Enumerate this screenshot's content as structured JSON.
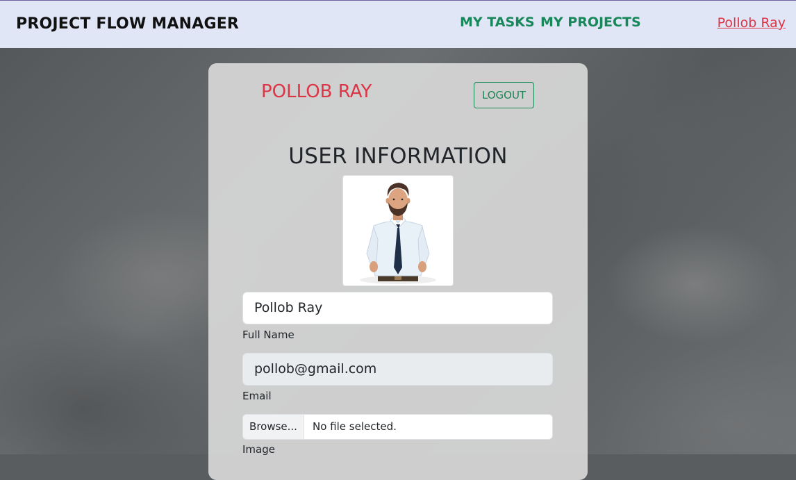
{
  "navbar": {
    "brand": "PROJECT FLOW MANAGER",
    "links": [
      "MY TASKS",
      "MY PROJECTS"
    ],
    "user_link": "Pollob Ray"
  },
  "card": {
    "username": "POLLOB RAY",
    "logout_label": "LOGOUT",
    "title": "USER INFORMATION",
    "full_name_value": "Pollob Ray",
    "full_name_label": "Full Name",
    "email_value": "pollob@gmail.com",
    "email_label": "Email",
    "file_button": "Browse...",
    "file_status": "No file selected.",
    "image_label": "Image"
  },
  "colors": {
    "accent_green": "#198754",
    "accent_red": "#dc3545",
    "navbar_bg": "#e0e6f6"
  }
}
